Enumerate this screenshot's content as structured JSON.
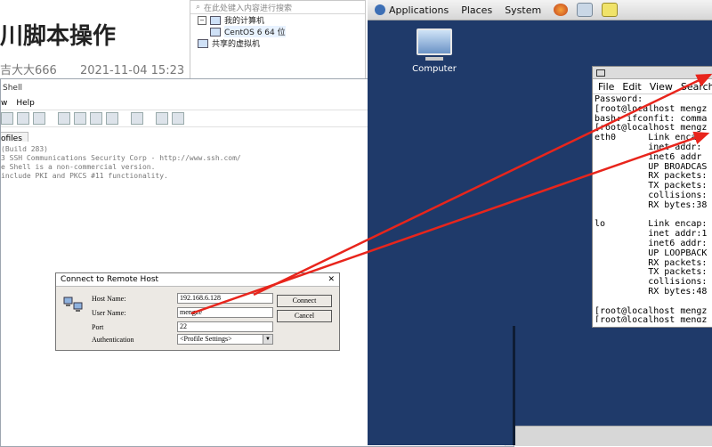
{
  "article": {
    "title": "川脚本操作",
    "author": "吉大大666",
    "date": "2021-11-04 15:23"
  },
  "vm_panel": {
    "search_placeholder": "在此处键入内容进行搜索",
    "my_computer": "我的计算机",
    "vm_name": "CentOS 6 64 位",
    "shared_vms": "共享的虚拟机"
  },
  "ssh_window": {
    "title": "Shell",
    "controls": {
      "minimize": "—",
      "maximize": "☐",
      "close": "✕"
    },
    "menu": [
      "w",
      "Help"
    ],
    "tab_label": "ofiles",
    "terminal_lines": [
      "(Build 283)",
      "3 SSH Communications Security Corp - http://www.ssh.com/",
      "",
      "e Shell is a non-commercial version.",
      "include PKI and PKCS #11 functionality."
    ]
  },
  "dialog": {
    "title": "Connect to Remote Host",
    "close": "✕",
    "host_label": "Host Name:",
    "host_value": "192.168.6.128",
    "user_label": "User Name:",
    "user_value": "mengze",
    "port_label": "Port",
    "port_value": "22",
    "auth_label": "Authentication",
    "auth_value": "<Profile Settings>",
    "connect_button": "Connect",
    "cancel_button": "Cancel"
  },
  "desktop": {
    "menu": [
      "Applications",
      "Places",
      "System"
    ],
    "computer_label": "Computer",
    "terminal": {
      "menu": [
        "File",
        "Edit",
        "View",
        "Search"
      ],
      "lines": [
        "Password:",
        "[root@localhost mengz",
        "bash: ifconfit: comma",
        "[root@localhost mengz",
        "eth0      Link encap",
        "          inet addr:",
        "          inet6 addr",
        "          UP BROADCAS",
        "          RX packets:",
        "          TX packets:",
        "          collisions:",
        "          RX bytes:38",
        "",
        "lo        Link encap:",
        "          inet addr:1",
        "          inet6 addr:",
        "          UP LOOPBACK",
        "          RX packets:",
        "          TX packets:",
        "          collisions:",
        "          RX bytes:48",
        "",
        "[root@localhost mengz",
        "[root@localhost mengz"
      ]
    }
  },
  "colors": {
    "arrow": "#e8251c",
    "desktop_bg": "#1f3a6a",
    "dialog_bg": "#ece9e4"
  }
}
